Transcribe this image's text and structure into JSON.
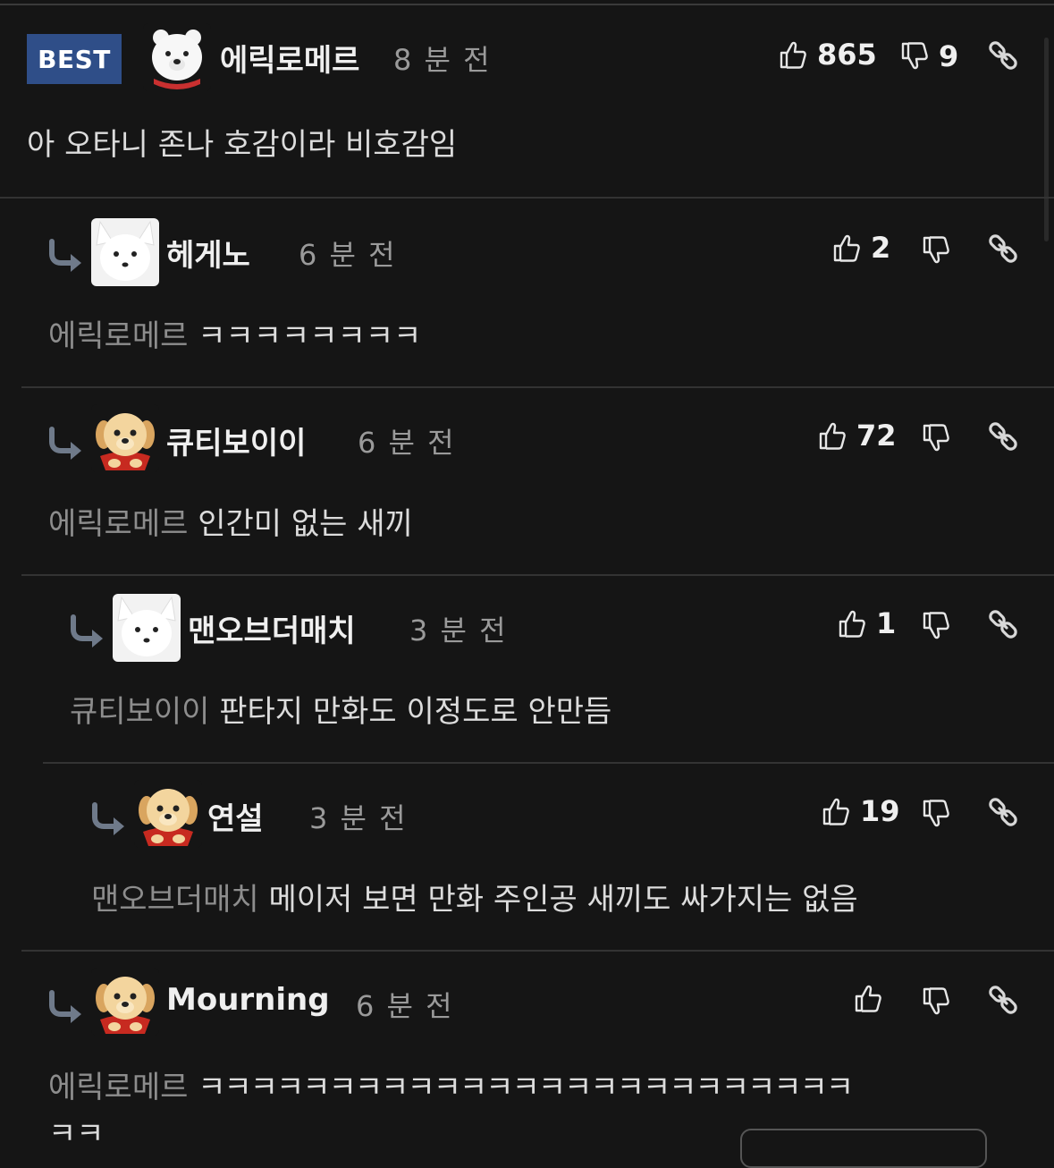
{
  "best_label": "BEST",
  "comments": [
    {
      "name": "에릭로메르",
      "time": "8 분 전",
      "likes": "865",
      "dislikes": "9",
      "body": "아 오타니 존나 호감이라 비호감임",
      "avatar": "polar-bear-avatar"
    },
    {
      "name": "헤게노",
      "time": "6 분 전",
      "likes": "2",
      "mention": "에릭로메르",
      "body": "ㅋㅋㅋㅋㅋㅋㅋㅋ",
      "avatar": "arctic-fox-avatar"
    },
    {
      "name": "큐티보이이",
      "time": "6 분 전",
      "likes": "72",
      "mention": "에릭로메르",
      "body": "인간미 없는 새끼",
      "avatar": "puppy-avatar"
    },
    {
      "name": "맨오브더매치",
      "time": "3 분 전",
      "likes": "1",
      "mention": "큐티보이이",
      "body": "판타지 만화도 이정도로 안만듬",
      "avatar": "arctic-fox-avatar"
    },
    {
      "name": "연설",
      "time": "3 분 전",
      "likes": "19",
      "mention": "맨오브더매치",
      "body": "메이저 보면 만화 주인공 새끼도 싸가지는 없음",
      "avatar": "puppy-avatar"
    },
    {
      "name": "Mourning",
      "time": "6 분 전",
      "likes": "",
      "mention": "에릭로메르",
      "body": "ㅋㅋㅋㅋㅋㅋㅋㅋㅋㅋㅋㅋㅋㅋㅋㅋㅋㅋㅋㅋㅋㅋㅋㅋㅋ",
      "body2": "ㅋㅋ",
      "avatar": "puppy-avatar"
    }
  ],
  "colors": {
    "background": "#151515",
    "best_badge": "#2f4e88",
    "mention": "#8d8d8d"
  }
}
